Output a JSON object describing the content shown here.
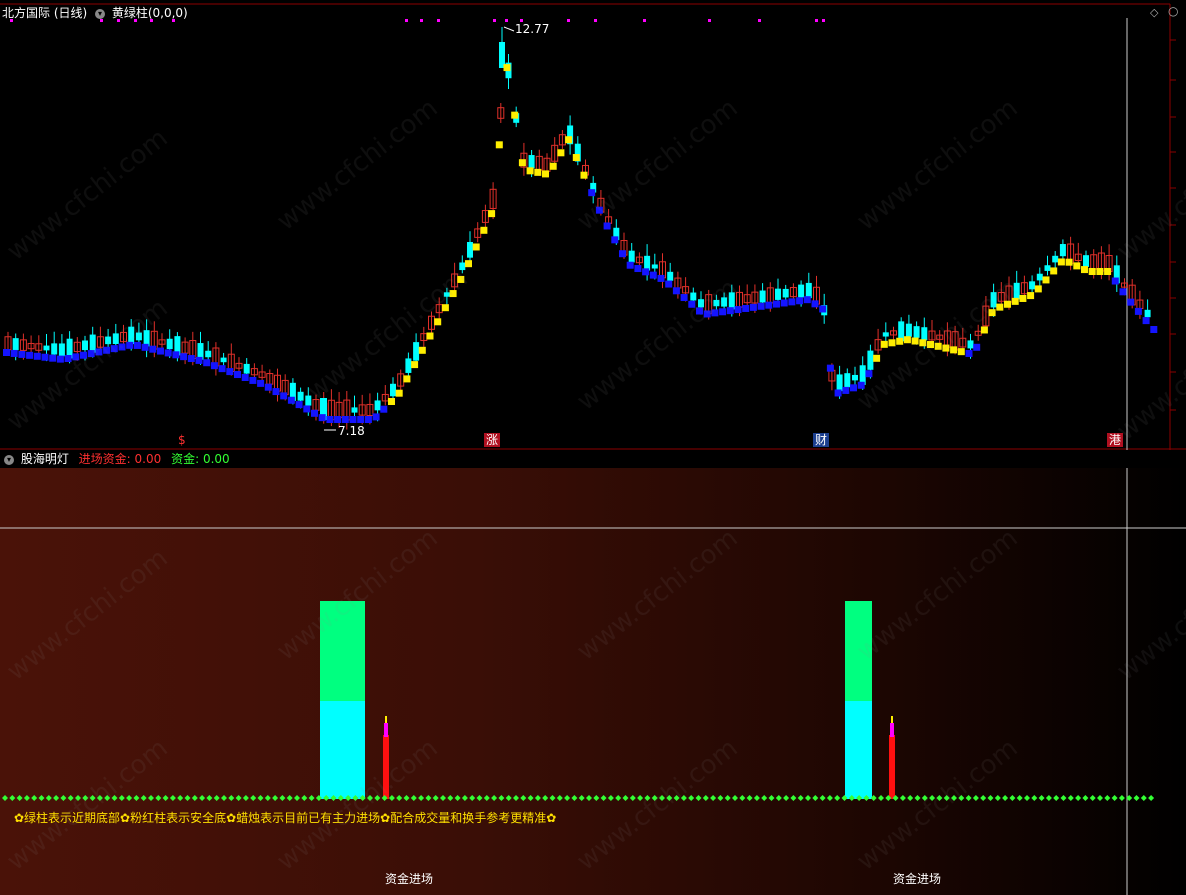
{
  "main": {
    "title": "北方国际 (日线)",
    "indicator": "黄绿柱(0,0,0)",
    "high_label": "12.77",
    "low_label": "7.18",
    "markers": [
      "$",
      "涨",
      "财",
      "港"
    ]
  },
  "sub": {
    "title": "股海明灯",
    "field1_label": "进场资金:",
    "field1_value": "0.00",
    "field2_label": "资金:",
    "field2_value": "0.00",
    "note": "✿绿柱表示近期底部✿粉红柱表示安全底✿蜡烛表示目前已有主力进场✿配合成交量和换手参考更精准✿",
    "signal_label_1": "资金进场",
    "signal_label_2": "资金进场"
  },
  "watermark": "www.cfchi.com",
  "colors": {
    "up": "#e0302a",
    "down": "#00ffff",
    "yellow": "#ffee00",
    "blue": "#1414ff",
    "green": "#00ff80",
    "dot": "#33ff33",
    "magenta": "#ff00ff"
  }
}
